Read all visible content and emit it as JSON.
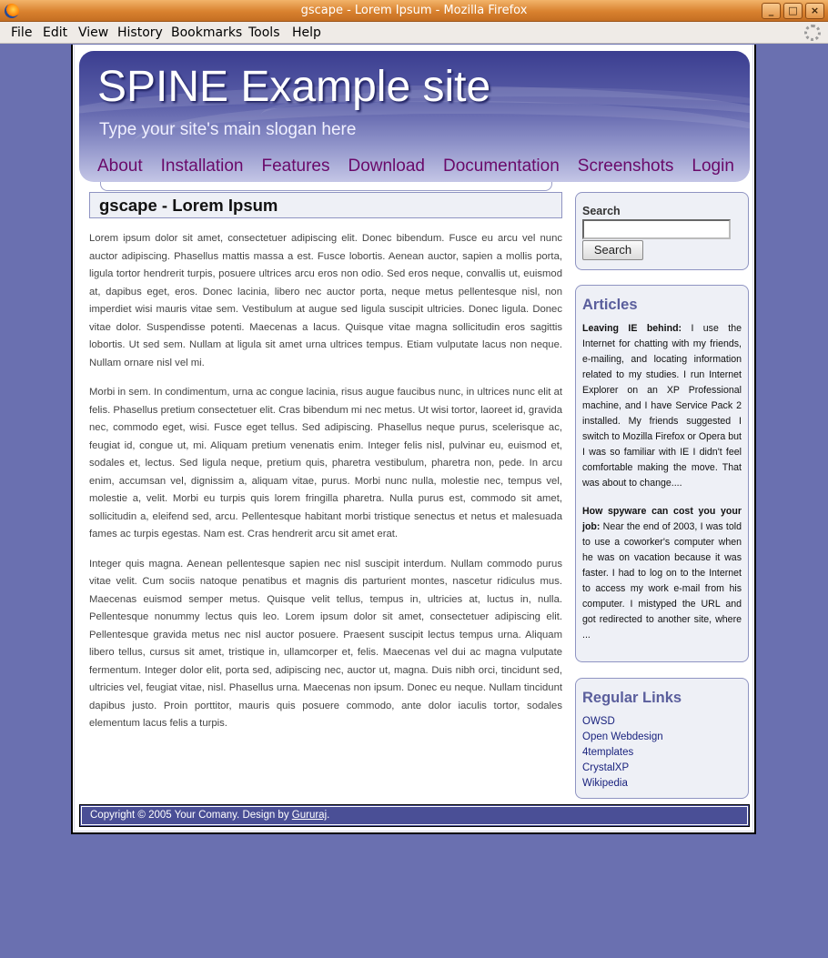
{
  "window": {
    "title": "gscape - Lorem Ipsum - Mozilla Firefox",
    "controls": [
      "_",
      "□",
      "×"
    ]
  },
  "menu": [
    "File",
    "Edit",
    "View",
    "History",
    "Bookmarks",
    "Tools",
    "Help"
  ],
  "site": {
    "title": "SPINE Example site",
    "slogan": "Type your site's main slogan here",
    "nav": [
      "About",
      "Installation",
      "Features",
      "Download",
      "Documentation",
      "Screenshots",
      "Login"
    ]
  },
  "post": {
    "title": "gscape - Lorem Ipsum",
    "paragraphs": [
      "Lorem ipsum dolor sit amet, consectetuer adipiscing elit. Donec bibendum. Fusce eu arcu vel nunc auctor adipiscing. Phasellus mattis massa a est. Fusce lobortis. Aenean auctor, sapien a mollis porta, ligula tortor hendrerit turpis, posuere ultrices arcu eros non odio. Sed eros neque, convallis ut, euismod at, dapibus eget, eros. Donec lacinia, libero nec auctor porta, neque metus pellentesque nisl, non imperdiet wisi mauris vitae sem. Vestibulum at augue sed ligula suscipit ultricies. Donec ligula. Donec vitae dolor. Suspendisse potenti. Maecenas a lacus. Quisque vitae magna sollicitudin eros sagittis lobortis. Ut sed sem. Nullam at ligula sit amet urna ultrices tempus. Etiam vulputate lacus non neque. Nullam ornare nisl vel mi.",
      "Morbi in sem. In condimentum, urna ac congue lacinia, risus augue faucibus nunc, in ultrices nunc elit at felis. Phasellus pretium consectetuer elit. Cras bibendum mi nec metus. Ut wisi tortor, laoreet id, gravida nec, commodo eget, wisi. Fusce eget tellus. Sed adipiscing. Phasellus neque purus, scelerisque ac, feugiat id, congue ut, mi. Aliquam pretium venenatis enim. Integer felis nisl, pulvinar eu, euismod et, sodales et, lectus. Sed ligula neque, pretium quis, pharetra vestibulum, pharetra non, pede. In arcu enim, accumsan vel, dignissim a, aliquam vitae, purus. Morbi nunc nulla, molestie nec, tempus vel, molestie a, velit. Morbi eu turpis quis lorem fringilla pharetra. Nulla purus est, commodo sit amet, sollicitudin a, eleifend sed, arcu. Pellentesque habitant morbi tristique senectus et netus et malesuada fames ac turpis egestas. Nam est. Cras hendrerit arcu sit amet erat.",
      "Integer quis magna. Aenean pellentesque sapien nec nisl suscipit interdum. Nullam commodo purus vitae velit. Cum sociis natoque penatibus et magnis dis parturient montes, nascetur ridiculus mus. Maecenas euismod semper metus. Quisque velit tellus, tempus in, ultricies at, luctus in, nulla. Pellentesque nonummy lectus quis leo. Lorem ipsum dolor sit amet, consectetuer adipiscing elit. Pellentesque gravida metus nec nisl auctor posuere. Praesent suscipit lectus tempus urna. Aliquam libero tellus, cursus sit amet, tristique in, ullamcorper et, felis. Maecenas vel dui ac magna vulputate fermentum. Integer dolor elit, porta sed, adipiscing nec, auctor ut, magna. Duis nibh orci, tincidunt sed, ultricies vel, feugiat vitae, nisl. Phasellus urna. Maecenas non ipsum. Donec eu neque. Nullam tincidunt dapibus justo. Proin porttitor, mauris quis posuere commodo, ante dolor iaculis tortor, sodales elementum lacus felis a turpis."
    ]
  },
  "sidebar": {
    "search": {
      "label": "Search",
      "button": "Search",
      "value": ""
    },
    "articles": {
      "heading": "Articles",
      "items": [
        {
          "title": "Leaving IE behind:",
          "text": " I use the Internet for chatting with my friends, e-mailing, and locating information related to my studies. I run Internet Explorer on an XP Professional machine, and I have Service Pack 2 installed. My friends suggested I switch to Mozilla Firefox or Opera but I was so familiar with IE I didn't feel comfortable making the move. That was about to change...."
        },
        {
          "title": "How spyware can cost you your job:",
          "text": " Near the end of 2003, I was told to use a coworker's computer when he was on vacation because it was faster. I had to log on to the Internet to access my work e-mail from his computer. I mistyped the URL and got redirected to another site, where ..."
        }
      ]
    },
    "links": {
      "heading": "Regular Links",
      "items": [
        "OWSD",
        "Open Webdesign",
        "4templates",
        "CrystalXP",
        "Wikipedia"
      ]
    }
  },
  "footer": {
    "text": "Copyright © 2005 Your Comany. Design by ",
    "link": "Gururaj",
    "end": "."
  },
  "colors": {
    "background": "#6a70b0",
    "nav_link": "#6a0a6a",
    "footer_bg": "#4a4f96",
    "sidebar_heading": "#5a5e9c"
  }
}
